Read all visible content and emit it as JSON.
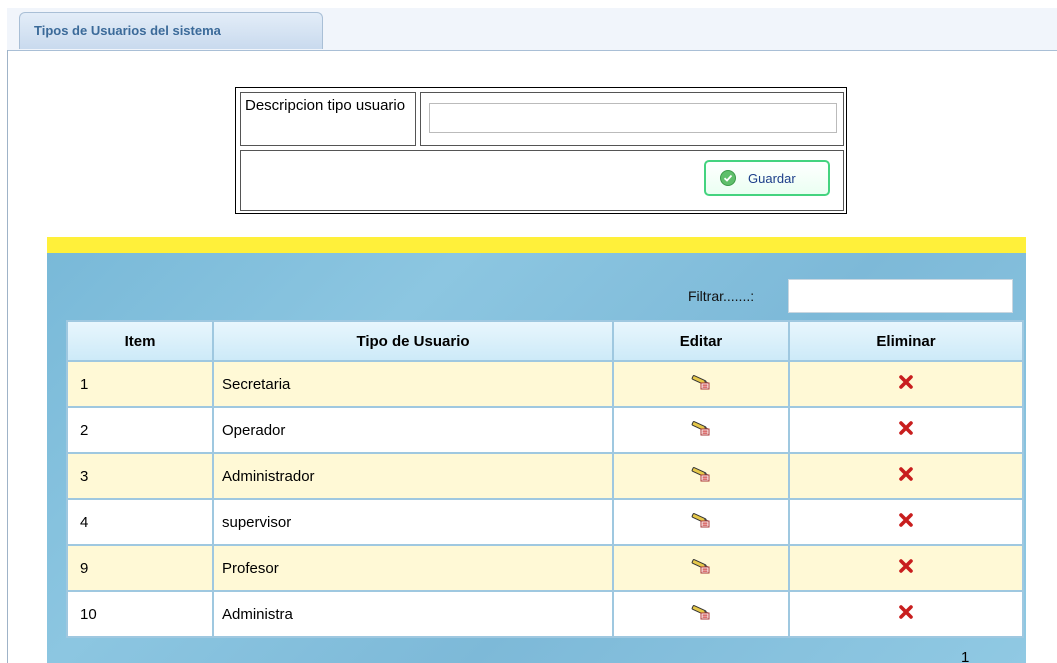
{
  "tab": {
    "title": "Tipos de Usuarios del sistema"
  },
  "form": {
    "description_label": "Descripcion tipo usuario",
    "description_value": "",
    "save_label": "Guardar"
  },
  "filter": {
    "label": "Filtrar.......:",
    "value": ""
  },
  "table": {
    "headers": [
      "Item",
      "Tipo de Usuario",
      "Editar",
      "Eliminar"
    ],
    "rows": [
      {
        "item": "1",
        "name": "Secretaria"
      },
      {
        "item": "2",
        "name": "Operador"
      },
      {
        "item": "3",
        "name": "Administrador"
      },
      {
        "item": "4",
        "name": "supervisor"
      },
      {
        "item": "9",
        "name": "Profesor"
      },
      {
        "item": "10",
        "name": "Administra"
      }
    ]
  },
  "pager": {
    "page": "1"
  },
  "icons": {
    "edit": "edit-pencil-icon",
    "delete": "delete-x-icon",
    "save": "check-circle-icon"
  },
  "colors": {
    "highlight_bar": "#fff03a",
    "panel": "#80bcdc",
    "odd_row": "#fff9d6",
    "button_border": "#44d37f"
  }
}
